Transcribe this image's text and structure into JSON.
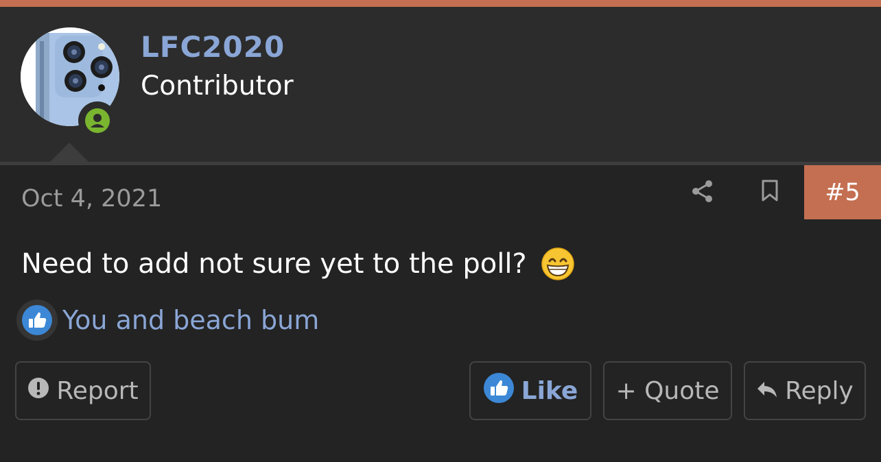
{
  "colors": {
    "accent": "#c46f51",
    "link": "#8aa6d6",
    "online": "#7ab530",
    "background": "#232323",
    "header_background": "#2c2c2c"
  },
  "user": {
    "name": "LFC2020",
    "title": "Contributor",
    "avatar_icon": "avatar-phone-photo",
    "online_icon": "user-online-icon"
  },
  "post": {
    "date": "Oct 4, 2021",
    "number": "#5",
    "message": "Need to add not sure yet to the poll?",
    "emoji": "grinning-face-emoji",
    "share_icon": "share-icon",
    "bookmark_icon": "bookmark-icon"
  },
  "reactions": {
    "icon": "thumbs-up-icon",
    "text": "You and beach bum"
  },
  "actions": {
    "report": "Report",
    "like": "Like",
    "quote": "+ Quote",
    "reply": "Reply"
  }
}
